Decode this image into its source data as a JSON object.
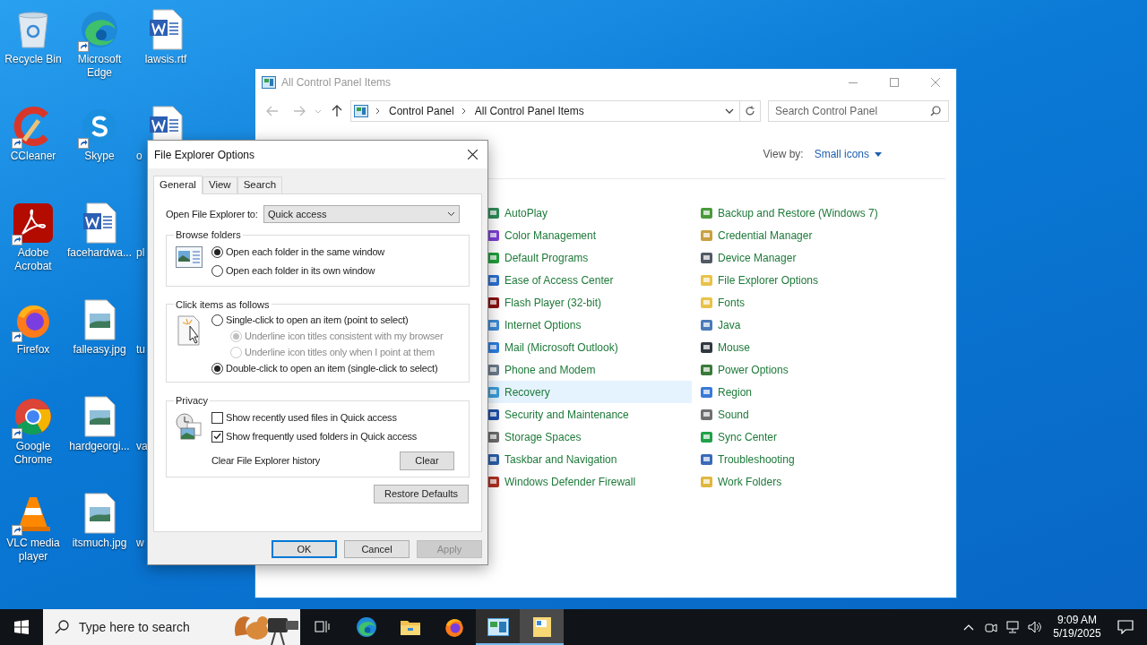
{
  "desktop_icons": [
    {
      "label": "Recycle Bin",
      "kind": "recycle",
      "shortcut": false
    },
    {
      "label": "CCleaner",
      "kind": "ccleaner",
      "shortcut": true
    },
    {
      "label": "Adobe Acrobat",
      "kind": "acrobat",
      "shortcut": true
    },
    {
      "label": "Firefox",
      "kind": "firefox",
      "shortcut": true
    },
    {
      "label": "Google Chrome",
      "kind": "chrome",
      "shortcut": true
    },
    {
      "label": "VLC media player",
      "kind": "vlc",
      "shortcut": true
    },
    {
      "label": "Microsoft Edge",
      "kind": "edge",
      "shortcut": true
    },
    {
      "label": "Skype",
      "kind": "skype",
      "shortcut": true
    },
    {
      "label": "facehardwa...",
      "kind": "word",
      "shortcut": false
    },
    {
      "label": "falleasy.jpg",
      "kind": "image",
      "shortcut": false
    },
    {
      "label": "hardgeorgi...",
      "kind": "image",
      "shortcut": false
    },
    {
      "label": "itsmuch.jpg",
      "kind": "image",
      "shortcut": false
    },
    {
      "label": "lawsis.rtf",
      "kind": "word",
      "shortcut": false
    },
    {
      "label": "o",
      "kind": "word-cut",
      "shortcut": false
    },
    {
      "label": "pl",
      "kind": "covered"
    },
    {
      "label": "tu",
      "kind": "covered"
    },
    {
      "label": "va",
      "kind": "covered"
    },
    {
      "label": "w",
      "kind": "covered"
    }
  ],
  "control_panel": {
    "title": "All Control Panel Items",
    "breadcrumb": [
      "Control Panel",
      "All Control Panel Items"
    ],
    "search": {
      "placeholder": "Search Control Panel"
    },
    "view_by": {
      "label": "View by:",
      "value": "Small icons"
    },
    "item_columns": [
      {
        "items": [
          {
            "label": "AutoPlay",
            "selected": false
          },
          {
            "label": "Color Management",
            "selected": false
          },
          {
            "label": "Default Programs",
            "selected": false
          },
          {
            "label": "Ease of Access Center",
            "selected": false
          },
          {
            "label": "Flash Player (32-bit)",
            "selected": false
          },
          {
            "label": "Internet Options",
            "selected": false
          },
          {
            "label": "Mail (Microsoft Outlook)",
            "selected": false
          },
          {
            "label": "Phone and Modem",
            "selected": false
          },
          {
            "label": "Recovery",
            "selected": true
          },
          {
            "label": "Security and Maintenance",
            "selected": false
          },
          {
            "label": "Storage Spaces",
            "selected": false
          },
          {
            "label": "Taskbar and Navigation",
            "selected": false
          },
          {
            "label": "Windows Defender Firewall",
            "selected": false
          }
        ]
      },
      {
        "items": [
          {
            "label": "Backup and Restore (Windows 7)",
            "selected": false
          },
          {
            "label": "Credential Manager",
            "selected": false
          },
          {
            "label": "Device Manager",
            "selected": false
          },
          {
            "label": "File Explorer Options",
            "selected": false
          },
          {
            "label": "Fonts",
            "selected": false
          },
          {
            "label": "Java",
            "selected": false
          },
          {
            "label": "Mouse",
            "selected": false
          },
          {
            "label": "Power Options",
            "selected": false
          },
          {
            "label": "Region",
            "selected": false
          },
          {
            "label": "Sound",
            "selected": false
          },
          {
            "label": "Sync Center",
            "selected": false
          },
          {
            "label": "Troubleshooting",
            "selected": false
          },
          {
            "label": "Work Folders",
            "selected": false
          }
        ]
      }
    ]
  },
  "dialog": {
    "title": "File Explorer Options",
    "tabs": [
      {
        "label": "General",
        "selected": true
      },
      {
        "label": "View",
        "selected": false
      },
      {
        "label": "Search",
        "selected": false
      }
    ],
    "open_to": {
      "label": "Open File Explorer to:",
      "value": "Quick access"
    },
    "groups": [
      {
        "title": "Browse folders",
        "options": [
          {
            "kind": "radio",
            "label": "Open each folder in the same window",
            "selected": true,
            "disabled": false
          },
          {
            "kind": "radio",
            "label": "Open each folder in its own window",
            "selected": false,
            "disabled": false
          }
        ]
      },
      {
        "title": "Click items as follows",
        "options": [
          {
            "kind": "radio",
            "label": "Single-click to open an item (point to select)",
            "selected": false,
            "disabled": false,
            "children": [
              {
                "kind": "radio",
                "label": "Underline icon titles consistent with my browser",
                "selected": true,
                "disabled": true
              },
              {
                "kind": "radio",
                "label": "Underline icon titles only when I point at them",
                "selected": false,
                "disabled": true
              }
            ]
          },
          {
            "kind": "radio",
            "label": "Double-click to open an item (single-click to select)",
            "selected": true,
            "disabled": false
          }
        ]
      },
      {
        "title": "Privacy",
        "options": [
          {
            "kind": "checkbox",
            "label": "Show recently used files in Quick access",
            "checked": false
          },
          {
            "kind": "checkbox",
            "label": "Show frequently used folders in Quick access",
            "checked": true
          },
          {
            "kind": "action",
            "label": "Clear File Explorer history",
            "button": "Clear"
          }
        ]
      }
    ],
    "restore_button": "Restore Defaults",
    "buttons": [
      {
        "label": "OK",
        "default": true,
        "disabled": false
      },
      {
        "label": "Cancel",
        "default": false,
        "disabled": false
      },
      {
        "label": "Apply",
        "default": false,
        "disabled": true
      }
    ]
  },
  "taskbar": {
    "search": {
      "placeholder": "Type here to search"
    },
    "apps": [
      {
        "kind": "taskview",
        "running": false,
        "selected": false
      },
      {
        "kind": "edge",
        "running": false,
        "selected": false
      },
      {
        "kind": "explorer",
        "running": false,
        "selected": false
      },
      {
        "kind": "firefox",
        "running": false,
        "selected": false
      },
      {
        "kind": "controlpanel",
        "running": true,
        "selected": false
      },
      {
        "kind": "folderoptions",
        "running": true,
        "selected": true
      }
    ],
    "time": "9:09 AM",
    "date": "5/19/2025"
  }
}
